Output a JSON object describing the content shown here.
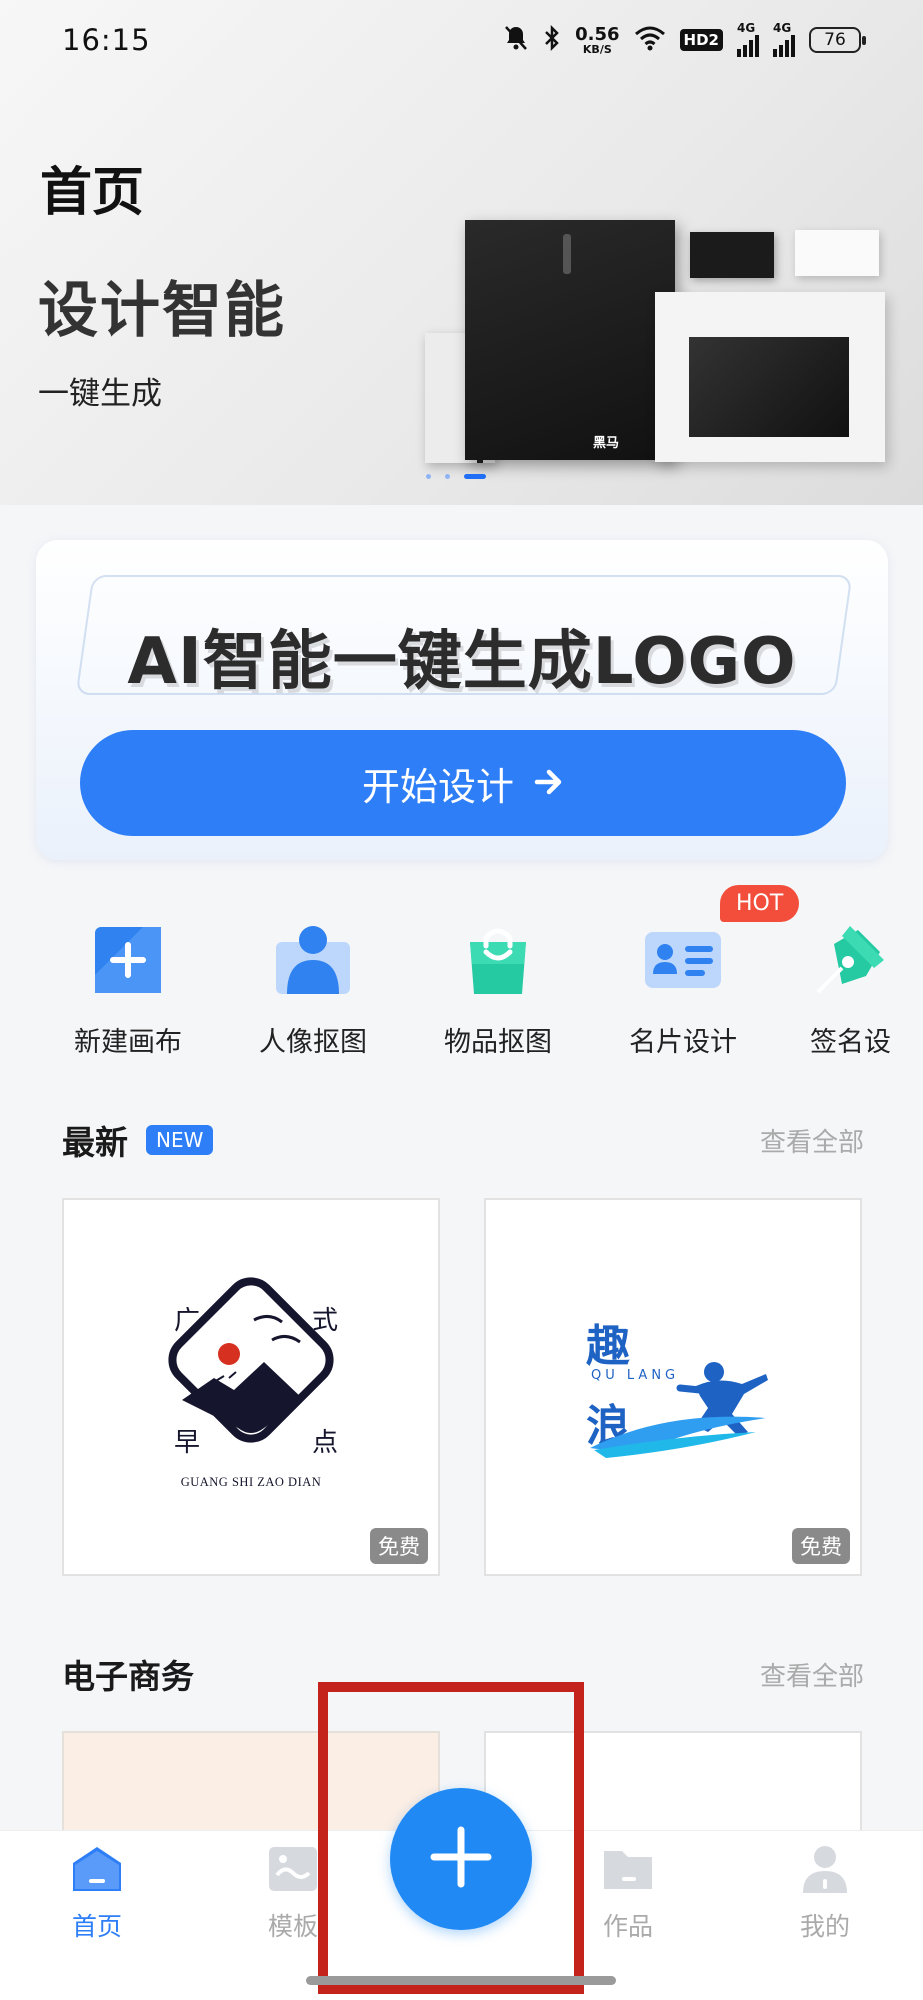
{
  "status_bar": {
    "time": "16:15",
    "net_speed_value": "0.56",
    "net_speed_unit": "KB/S",
    "hd_label": "HD2",
    "signal1_label": "4G",
    "signal2_label": "4G",
    "battery": "76"
  },
  "hero": {
    "page_title": "首页",
    "headline": "设计智能",
    "subtitle": "一键生成",
    "mockup_brand": "黑马",
    "carousel_active_index": 2,
    "carousel_count": 3
  },
  "ai_banner": {
    "title": "AI智能一键生成LOGO",
    "button_label": "开始设计",
    "button_arrow": "→"
  },
  "tools": {
    "hot_badge": "HOT",
    "items": [
      {
        "label": "新建画布",
        "icon": "plus-square-icon"
      },
      {
        "label": "人像抠图",
        "icon": "portrait-icon"
      },
      {
        "label": "物品抠图",
        "icon": "shopping-bag-icon"
      },
      {
        "label": "名片设计",
        "icon": "business-card-icon"
      },
      {
        "label": "签名设",
        "icon": "pen-nib-icon"
      }
    ]
  },
  "latest": {
    "title": "最新",
    "badge": "NEW",
    "more": "查看全部",
    "cards": [
      {
        "free": "免费",
        "logo_chars": [
          "广",
          "式",
          "早",
          "点"
        ],
        "logo_caption": "GUANG SHI ZAO DIAN"
      },
      {
        "free": "免费",
        "logo_chars": [
          "趣",
          "浪"
        ],
        "logo_caption": "QU LANG"
      }
    ]
  },
  "ecommerce": {
    "title": "电子商务",
    "more": "查看全部"
  },
  "bottom_nav": {
    "items": [
      {
        "label": "首页",
        "icon": "home-icon",
        "active": true
      },
      {
        "label": "模板",
        "icon": "image-template-icon",
        "active": false
      },
      {
        "label": "作品",
        "icon": "folder-icon",
        "active": false
      },
      {
        "label": "我的",
        "icon": "user-icon",
        "active": false
      }
    ],
    "fab_icon": "plus-icon"
  },
  "colors": {
    "accent": "#2d7ef7",
    "fab": "#2089f4",
    "hot": "#f24e3b",
    "highlight": "#c3231b"
  }
}
